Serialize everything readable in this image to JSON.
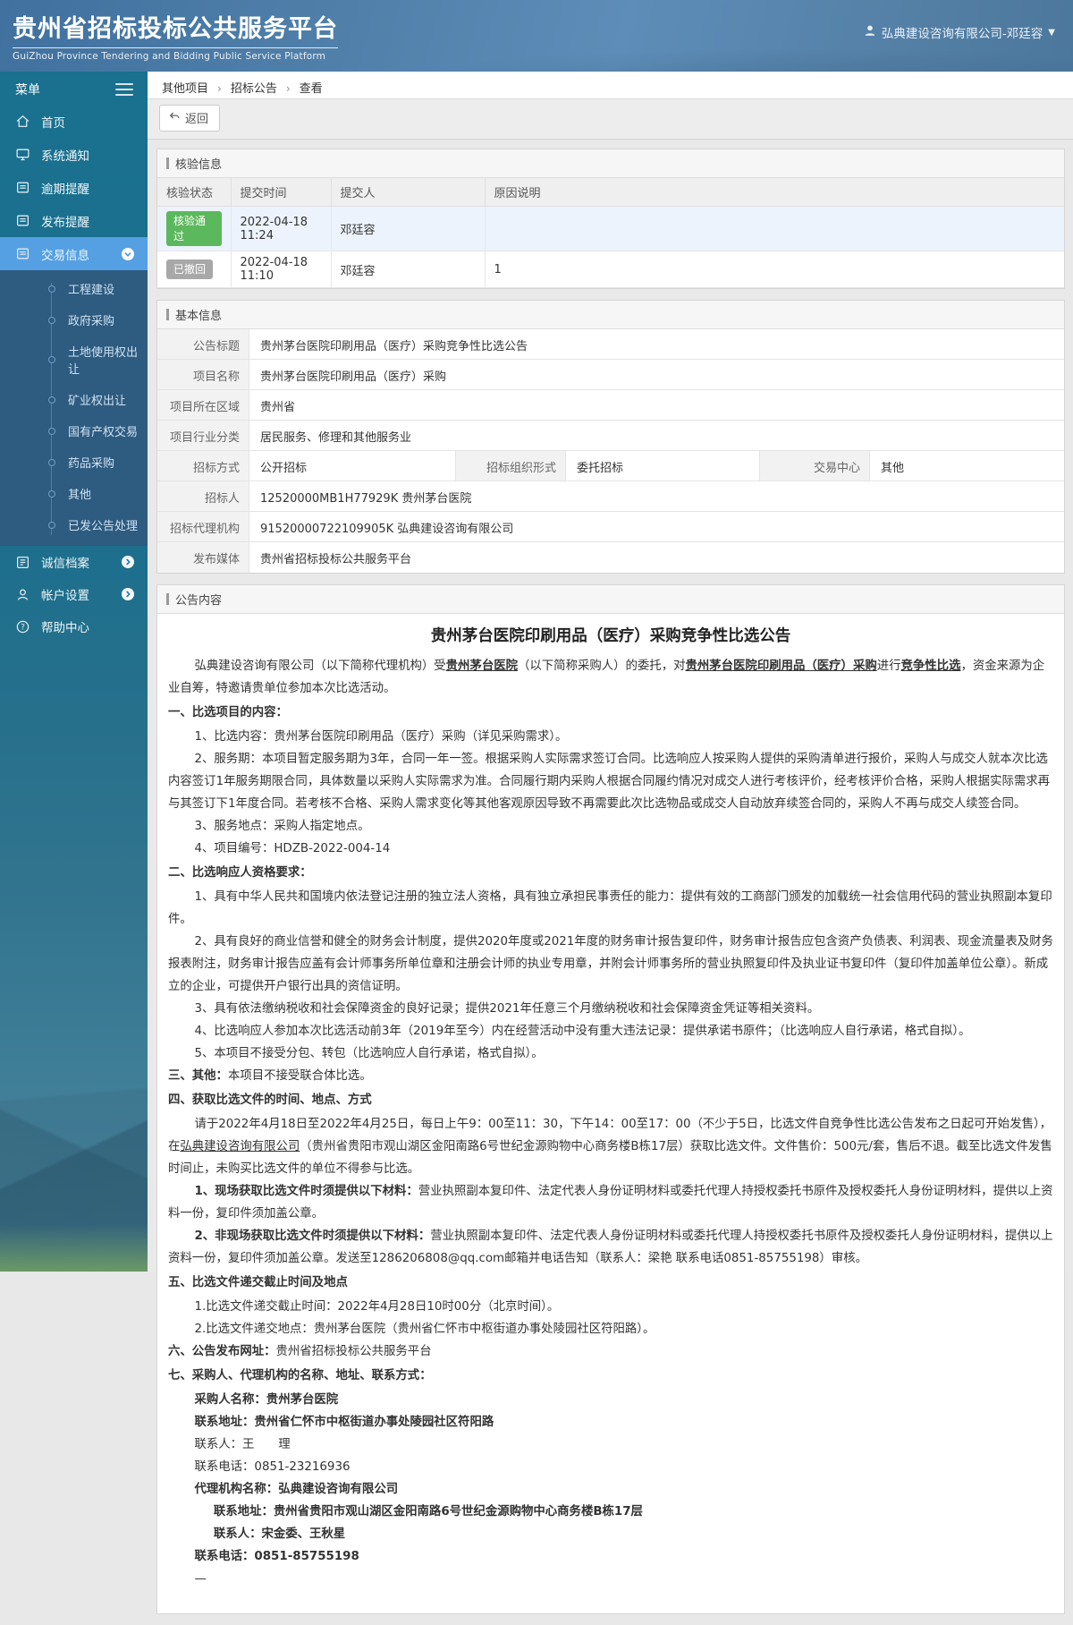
{
  "header": {
    "title_cn": "贵州省招标投标公共服务平台",
    "title_en": "GuiZhou Province Tendering and Bidding Public Service Platform",
    "user": "弘典建设咨询有限公司-邓廷容"
  },
  "colors": {
    "accent": "#2077b2",
    "sidebar_active": "#55a0e3",
    "status_success": "#5cb85c",
    "status_revoked": "#a8a8a8"
  },
  "sidebar": {
    "menu_label": "菜单",
    "items": [
      {
        "label": "首页",
        "icon": "home-icon",
        "active": false,
        "expanded": false
      },
      {
        "label": "系统通知",
        "icon": "monitor-icon",
        "active": false,
        "expanded": false
      },
      {
        "label": "逾期提醒",
        "icon": "folder-icon",
        "active": false,
        "expanded": false
      },
      {
        "label": "发布提醒",
        "icon": "folder-icon",
        "active": false,
        "expanded": false
      },
      {
        "label": "交易信息",
        "icon": "folder-icon",
        "active": true,
        "expanded": true
      }
    ],
    "submenu": [
      "工程建设",
      "政府采购",
      "土地使用权出让",
      "矿业权出让",
      "国有产权交易",
      "药品采购",
      "其他",
      "已发公告处理"
    ],
    "lower_items": [
      {
        "label": "诚信档案",
        "icon": "archive-icon",
        "chevron": true
      },
      {
        "label": "帐户设置",
        "icon": "user-icon",
        "chevron": true
      },
      {
        "label": "帮助中心",
        "icon": "help-icon",
        "chevron": false
      }
    ]
  },
  "breadcrumb": [
    "其他项目",
    "招标公告",
    "查看"
  ],
  "toolbar": {
    "back_label": "返回"
  },
  "verification": {
    "title": "核验信息",
    "headers": [
      "核验状态",
      "提交时间",
      "提交人",
      "原因说明"
    ],
    "rows": [
      {
        "status": "核验通过",
        "status_type": "success",
        "time": "2022-04-18 11:24",
        "submitter": "邓廷容",
        "reason": ""
      },
      {
        "status": "已撤回",
        "status_type": "revoked",
        "time": "2022-04-18 11:10",
        "submitter": "邓廷容",
        "reason": "1"
      }
    ]
  },
  "basic_info": {
    "title": "基本信息",
    "rows_top": [
      {
        "label": "公告标题",
        "value": "贵州茅台医院印刷用品（医疗）采购竞争性比选公告"
      },
      {
        "label": "项目名称",
        "value": "贵州茅台医院印刷用品（医疗）采购"
      },
      {
        "label": "项目所在区域",
        "value": "贵州省"
      },
      {
        "label": "项目行业分类",
        "value": "居民服务、修理和其他服务业"
      }
    ],
    "triple_row": [
      {
        "label": "招标方式",
        "value": "公开招标"
      },
      {
        "label": "招标组织形式",
        "value": "委托招标"
      },
      {
        "label": "交易中心",
        "value": "其他"
      }
    ],
    "rows_bottom": [
      {
        "label": "招标人",
        "value": "12520000MB1H77929K 贵州茅台医院"
      },
      {
        "label": "招标代理机构",
        "value": "91520000722109905K 弘典建设咨询有限公司"
      },
      {
        "label": "发布媒体",
        "value": "贵州省招标投标公共服务平台"
      }
    ]
  },
  "announcement": {
    "title": "公告内容",
    "doc_title": "贵州茅台医院印刷用品（医疗）采购竞争性比选公告",
    "paragraphs": [
      {
        "style": "fp",
        "parts": [
          {
            "t": "弘典建设咨询有限公司（以下简称代理机构）受"
          },
          {
            "t": "贵州茅台医院",
            "b": true,
            "u": true
          },
          {
            "t": "（以下简称采购人）的委托，对"
          },
          {
            "t": "贵州茅台医院印刷用品（医疗）采购",
            "b": true,
            "u": true
          },
          {
            "t": "进行"
          },
          {
            "t": "竞争性比选",
            "b": true,
            "u": true
          },
          {
            "t": "，资金来源为企业自筹，特邀请贵单位参加本次比选活动。"
          }
        ]
      },
      {
        "style": "head",
        "parts": [
          {
            "t": "一、比选项目的内容："
          }
        ]
      },
      {
        "style": "fp",
        "parts": [
          {
            "t": "1、比选内容：贵州茅台医院印刷用品（医疗）采购（详见采购需求）。"
          }
        ]
      },
      {
        "style": "fp",
        "parts": [
          {
            "t": "2、服务期：本项目暂定服务期为3年，合同一年一签。根据采购人实际需求签订合同。比选响应人按采购人提供的采购清单进行报价，采购人与成交人就本次比选内容签订1年服务期限合同，具体数量以采购人实际需求为准。合同履行期内采购人根据合同履约情况对成交人进行考核评价，经考核评价合格，采购人根据实际需求再与其签订下1年度合同。若考核不合格、采购人需求变化等其他客观原因导致不再需要此次比选物品或成交人自动放弃续签合同的，采购人不再与成交人续签合同。"
          }
        ]
      },
      {
        "style": "fp",
        "parts": [
          {
            "t": "3、服务地点：采购人指定地点。"
          }
        ]
      },
      {
        "style": "fp",
        "parts": [
          {
            "t": "4、项目编号：HDZB-2022-004-14"
          }
        ]
      },
      {
        "style": "head",
        "parts": [
          {
            "t": "二、比选响应人资格要求："
          }
        ]
      },
      {
        "style": "fp",
        "parts": [
          {
            "t": "1、具有中华人民共和国境内依法登记注册的独立法人资格，具有独立承担民事责任的能力：提供有效的工商部门颁发的加载统一社会信用代码的营业执照副本复印件。"
          }
        ]
      },
      {
        "style": "fp",
        "parts": [
          {
            "t": "2、具有良好的商业信誉和健全的财务会计制度，提供2020年度或2021年度的财务审计报告复印件，财务审计报告应包含资产负债表、利润表、现金流量表及财务报表附注，财务审计报告应盖有会计师事务所单位章和注册会计师的执业专用章，并附会计师事务所的营业执照复印件及执业证书复印件（复印件加盖单位公章）。新成立的企业，可提供开户银行出具的资信证明。"
          }
        ]
      },
      {
        "style": "fp",
        "parts": [
          {
            "t": "3、具有依法缴纳税收和社会保障资金的良好记录；提供2021年任意三个月缴纳税收和社会保障资金凭证等相关资料。"
          }
        ]
      },
      {
        "style": "fp",
        "parts": [
          {
            "t": "4、比选响应人参加本次比选活动前3年（2019年至今）内在经营活动中没有重大违法记录：提供承诺书原件；（比选响应人自行承诺，格式自拟）。"
          }
        ]
      },
      {
        "style": "fp",
        "parts": [
          {
            "t": "5、本项目不接受分包、转包（比选响应人自行承诺，格式自拟）。"
          }
        ]
      },
      {
        "style": "",
        "parts": [
          {
            "t": "三、其他：",
            "b": true
          },
          {
            "t": "本项目不接受联合体比选。"
          }
        ]
      },
      {
        "style": "head",
        "parts": [
          {
            "t": "四、获取比选文件的时间、地点、方式"
          }
        ]
      },
      {
        "style": "fp",
        "parts": [
          {
            "t": "请于2022年4月18日至2022年4月25日，每日上午9：00至11：30，下午14：00至17：00（不少于5日，比选文件自竞争性比选公告发布之日起可开始发售），在"
          },
          {
            "t": "弘典建设咨询有限公司",
            "u": true
          },
          {
            "t": "（贵州省贵阳市观山湖区金阳南路6号世纪金源购物中心商务楼B栋17层）获取比选文件。文件售价：500元/套，售后不退。截至比选文件发售时间止，未购买比选文件的单位不得参与比选。"
          }
        ]
      },
      {
        "style": "fp",
        "parts": [
          {
            "t": "1、现场获取比选文件时须提供以下材料：",
            "b": true
          },
          {
            "t": "营业执照副本复印件、法定代表人身份证明材料或委托代理人持授权委托书原件及授权委托人身份证明材料，提供以上资料一份，复印件须加盖公章。"
          }
        ]
      },
      {
        "style": "fp",
        "parts": [
          {
            "t": "2、非现场获取比选文件时须提供以下材料：",
            "b": true
          },
          {
            "t": "营业执照副本复印件、法定代表人身份证明材料或委托代理人持授权委托书原件及授权委托人身份证明材料，提供以上资料一份，复印件须加盖公章。发送至1286206808@qq.com邮箱并电话告知（联系人：梁艳 联系电话0851-85755198）审核。"
          }
        ]
      },
      {
        "style": "head",
        "parts": [
          {
            "t": "五、比选文件递交截止时间及地点"
          }
        ]
      },
      {
        "style": "ind1",
        "parts": [
          {
            "t": "1.比选文件递交截止时间：2022年4月28日10时00分（北京时间）。"
          }
        ]
      },
      {
        "style": "ind1",
        "parts": [
          {
            "t": "2.比选文件递交地点：贵州茅台医院（贵州省仁怀市中枢街道办事处陵园社区符阳路）。"
          }
        ]
      },
      {
        "style": "",
        "parts": [
          {
            "t": "六、公告发布网址：",
            "b": true
          },
          {
            "t": "贵州省招标投标公共服务平台"
          }
        ]
      },
      {
        "style": "head",
        "parts": [
          {
            "t": "七、采购人、代理机构的名称、地址、联系方式："
          }
        ]
      },
      {
        "style": "ind1",
        "parts": [
          {
            "t": "采购人名称：贵州茅台医院",
            "b": true
          }
        ]
      },
      {
        "style": "ind1",
        "parts": [
          {
            "t": "联系地址：贵州省仁怀市中枢街道办事处陵园社区符阳路",
            "b": true
          }
        ]
      },
      {
        "style": "ind1",
        "parts": [
          {
            "t": "联系人：王　　理"
          }
        ]
      },
      {
        "style": "ind1",
        "parts": [
          {
            "t": "联系电话：0851-23216936"
          }
        ]
      },
      {
        "style": "ind1",
        "parts": [
          {
            "t": "代理机构名称：弘典建设咨询有限公司",
            "b": true
          }
        ]
      },
      {
        "style": "ind2",
        "parts": [
          {
            "t": "联系地址：贵州省贵阳市观山湖区金阳南路6号世纪金源购物中心商务楼B栋17层",
            "b": true
          }
        ]
      },
      {
        "style": "ind2",
        "parts": [
          {
            "t": "联系人：宋金委、王秋星",
            "b": true
          }
        ]
      },
      {
        "style": "ind1",
        "parts": [
          {
            "t": "联系电话：0851-85755198",
            "b": true
          }
        ]
      },
      {
        "style": "ind1",
        "parts": [
          {
            "t": "—"
          }
        ]
      }
    ]
  }
}
